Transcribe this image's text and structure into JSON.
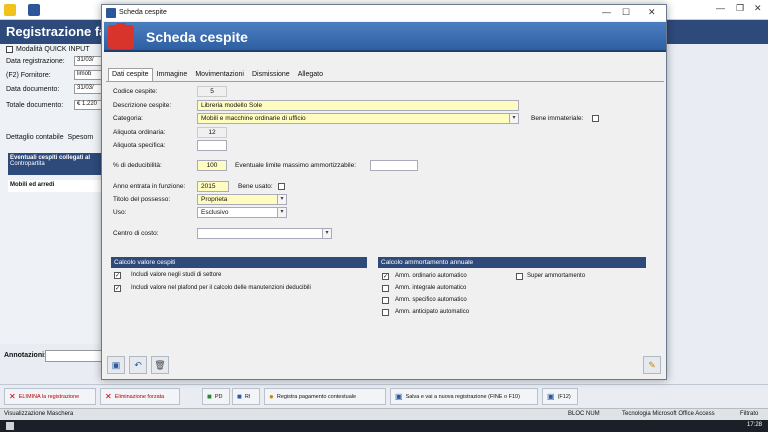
{
  "background": {
    "heading": "Registrazione fatt",
    "quick_input": "Modalità QUICK INPUT",
    "fields": [
      {
        "label": "Data registrazione:",
        "value": "31/03/"
      },
      {
        "label": "(F2) Fornitore:",
        "value": "limob"
      },
      {
        "label": "Data documento:",
        "value": "31/03/"
      },
      {
        "label": "Totale documento:",
        "value": "€ 1.220"
      }
    ],
    "tabs": [
      "Dettaglio contabile",
      "Spesom"
    ],
    "panel_title": "Eventuali cespiti collegati al",
    "panel_col": "Contropartita",
    "panel_row": "Mobili ed arredi",
    "annotations_label": "Annotazioni:"
  },
  "buttons": {
    "delete": "ELIMINA la registrazione",
    "force_delete": "Eliminazione forzata",
    "pd": "PD",
    "ri": "RI",
    "payment": "Registra pagamento contestuale",
    "save_new": "Salva e vai a nuova registrazione (FINE o F10)",
    "f12": "(F12)"
  },
  "status": {
    "left": "Visualizzazione Maschera",
    "num": "BLOC NUM",
    "tech": "Tecnologia Microsoft Office Access",
    "filter": "Filtrato",
    "clock": "17:28"
  },
  "dialog": {
    "window_title": "Scheda cespite",
    "header_title": "Scheda cespite",
    "tabs": [
      "Dati cespite",
      "Immagine",
      "Movimentazioni",
      "Dismissione",
      "Allegato"
    ],
    "codice_label": "Codice cespite:",
    "codice_value": "5",
    "descrizione_label": "Descrizione cespite:",
    "descrizione_value": "Libreria modello Sole",
    "categoria_label": "Categoria:",
    "categoria_value": "Mobili e macchine ordinarie di ufficio",
    "bene_immateriale_label": "Bene immateriale:",
    "aliquota_ord_label": "Aliquota ordinaria:",
    "aliquota_ord_value": "12",
    "aliquota_spec_label": "Aliquota specifica:",
    "deducibilita_label": "% di deducibilità:",
    "deducibilita_value": "100",
    "limite_label": "Eventuale limite massimo ammortizzabile:",
    "anno_label": "Anno entrata in funzione:",
    "anno_value": "2015",
    "bene_usato_label": "Bene usato:",
    "titolo_label": "Titolo del possesso:",
    "titolo_value": "Proprieta",
    "uso_label": "Uso:",
    "uso_value": "Esclusivo",
    "centro_label": "Centro di costo:",
    "calcolo_valore_title": "Calcolo valore cespiti",
    "calcolo_valore_opts": [
      {
        "label": "Includi valore negli studi di settore",
        "checked": true
      },
      {
        "label": "Includi valore nel plafond per il calcolo delle manutenzioni deducibili",
        "checked": true
      }
    ],
    "calcolo_amm_title": "Calcolo ammortamento annuale",
    "calcolo_amm_opts": [
      {
        "label": "Amm. ordinario automatico",
        "checked": true
      },
      {
        "label": "Amm. integrale automatico",
        "checked": false
      },
      {
        "label": "Amm. specifico automatico",
        "checked": false
      },
      {
        "label": "Amm. anticipato automatico",
        "checked": false
      }
    ],
    "super_amm_label": "Super ammortamento"
  }
}
